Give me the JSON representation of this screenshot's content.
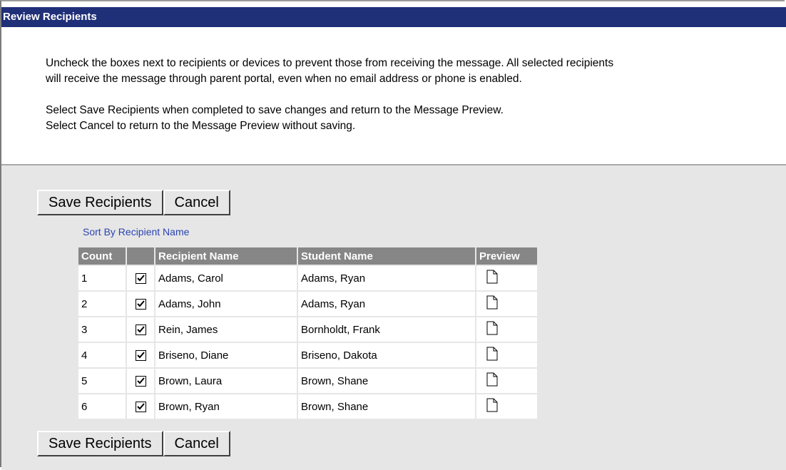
{
  "header": {
    "title": "Review Recipients"
  },
  "instructions": {
    "line1": "Uncheck the boxes next to recipients or devices to prevent those from receiving the message. All selected recipients",
    "line2": "will receive the message through parent portal, even when no email address or phone is enabled.",
    "line3": "Select Save Recipients when completed to save changes and return to the Message Preview.",
    "line4": "Select Cancel to return to the Message Preview without saving."
  },
  "buttons": {
    "save": "Save Recipients",
    "cancel": "Cancel"
  },
  "sort_link": "Sort By Recipient Name",
  "table": {
    "headers": {
      "count": "Count",
      "check": "",
      "recipient": "Recipient Name",
      "student": "Student Name",
      "preview": "Preview"
    },
    "rows": [
      {
        "count": "1",
        "checked": true,
        "recipient": "Adams, Carol",
        "student": "Adams, Ryan",
        "preview_icon": "document-icon"
      },
      {
        "count": "2",
        "checked": true,
        "recipient": "Adams, John",
        "student": "Adams, Ryan",
        "preview_icon": "document-icon"
      },
      {
        "count": "3",
        "checked": true,
        "recipient": "Rein, James",
        "student": "Bornholdt, Frank",
        "preview_icon": "document-icon"
      },
      {
        "count": "4",
        "checked": true,
        "recipient": "Briseno, Diane",
        "student": "Briseno, Dakota",
        "preview_icon": "document-icon"
      },
      {
        "count": "5",
        "checked": true,
        "recipient": "Brown, Laura",
        "student": "Brown, Shane",
        "preview_icon": "document-icon"
      },
      {
        "count": "6",
        "checked": true,
        "recipient": "Brown, Ryan",
        "student": "Brown, Shane",
        "preview_icon": "document-icon"
      }
    ]
  },
  "colors": {
    "titlebar": "#1f2f78",
    "panel": "#e6e6e6",
    "header_cell": "#868686",
    "link": "#2a44b0"
  }
}
